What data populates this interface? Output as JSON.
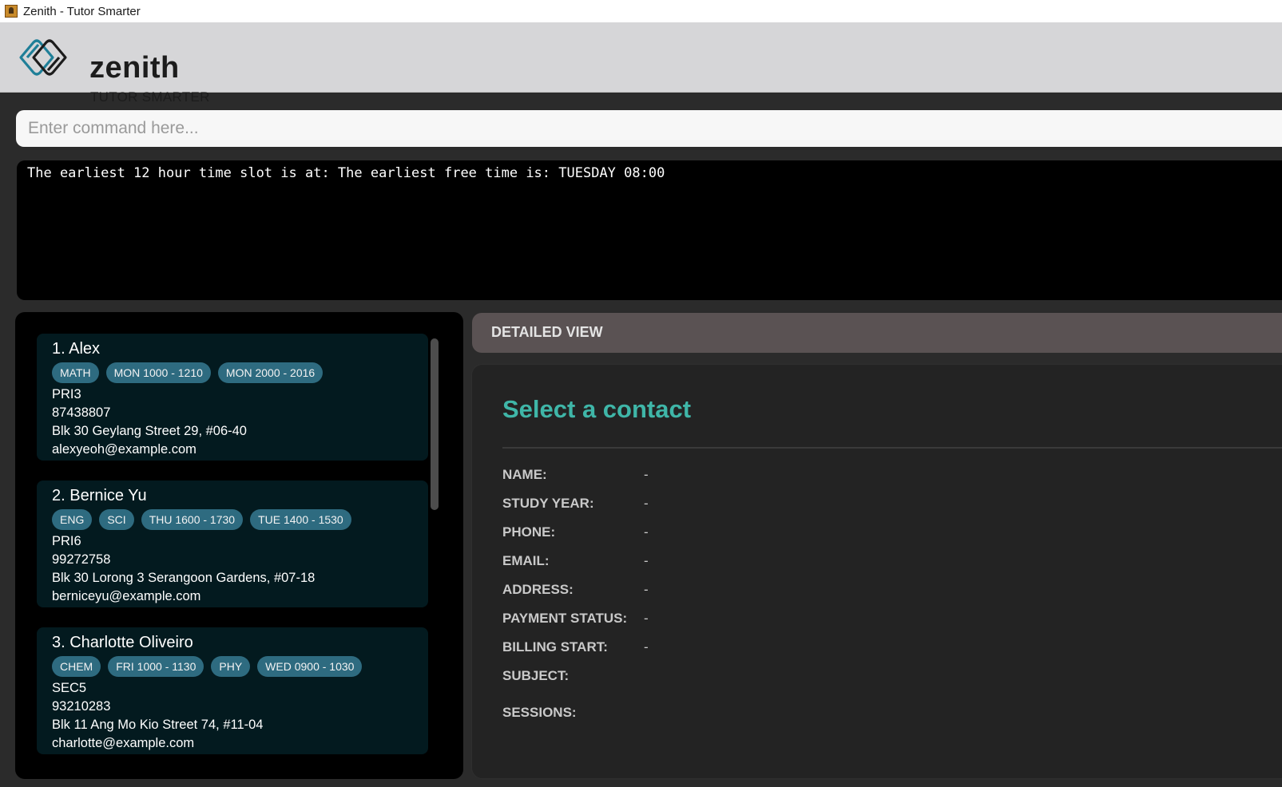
{
  "window": {
    "title": "Zenith - Tutor Smarter"
  },
  "header": {
    "brand_name": "zenith",
    "tagline": "TUTOR SMARTER"
  },
  "command": {
    "placeholder": "Enter command here...",
    "value": ""
  },
  "result": {
    "text": "The earliest 12 hour time slot is at: The earliest free time is: TUESDAY 08:00"
  },
  "contacts": [
    {
      "name": "1. Alex",
      "tags": [
        "MATH",
        "MON 1000 - 1210",
        "MON 2000 - 2016"
      ],
      "study_year": "PRI3",
      "phone": "87438807",
      "address": "Blk 30 Geylang Street 29, #06-40",
      "email": "alexyeoh@example.com"
    },
    {
      "name": "2. Bernice Yu",
      "tags": [
        "ENG",
        "SCI",
        "THU 1600 - 1730",
        "TUE 1400 - 1530"
      ],
      "study_year": "PRI6",
      "phone": "99272758",
      "address": "Blk 30 Lorong 3 Serangoon Gardens, #07-18",
      "email": "berniceyu@example.com"
    },
    {
      "name": "3. Charlotte Oliveiro",
      "tags": [
        "CHEM",
        "FRI 1000 - 1130",
        "PHY",
        "WED 0900 - 1030"
      ],
      "study_year": "SEC5",
      "phone": "93210283",
      "address": "Blk 11 Ang Mo Kio Street 74, #11-04",
      "email": "charlotte@example.com"
    }
  ],
  "detail": {
    "header": "DETAILED VIEW",
    "title": "Select a contact",
    "fields": [
      {
        "label": "NAME:",
        "value": "-"
      },
      {
        "label": "STUDY YEAR:",
        "value": "-"
      },
      {
        "label": "PHONE:",
        "value": "-"
      },
      {
        "label": "EMAIL:",
        "value": "-"
      },
      {
        "label": "ADDRESS:",
        "value": "-"
      },
      {
        "label": "PAYMENT STATUS:",
        "value": "-"
      },
      {
        "label": "BILLING START:",
        "value": "-"
      },
      {
        "label": "SUBJECT:",
        "value": ""
      },
      {
        "label": "SESSIONS:",
        "value": ""
      }
    ]
  },
  "colors": {
    "accent": "#3fb6a8",
    "tag": "#2e6b80",
    "card": "#031a1f"
  }
}
